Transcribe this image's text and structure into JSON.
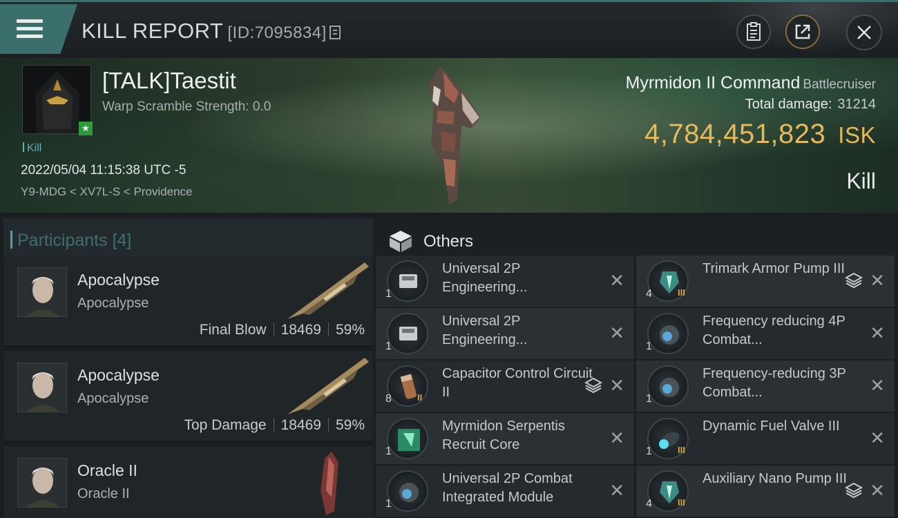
{
  "header": {
    "title": "KILL REPORT",
    "report_id": "[ID:7095834]"
  },
  "victim": {
    "name": "[TALK]Taestit",
    "warp_scramble": "Warp Scramble Strength: 0.0",
    "tag": "Kill",
    "datetime": "2022/05/04 11:15:38 UTC -5",
    "location": "Y9-MDG < XV7L-S < Providence",
    "ship": "Myrmidon II Command",
    "ship_class": "Battlecruiser",
    "total_damage_label": "Total damage:",
    "total_damage": "31214",
    "isk_value": "4,784,451,823",
    "isk_unit": "ISK",
    "result": "Kill"
  },
  "participants": {
    "label": "Participants",
    "count": "[4]",
    "rows": [
      {
        "ship": "Apocalypse",
        "type": "Apocalypse",
        "role": "Final Blow",
        "damage": "18469",
        "percent": "59%"
      },
      {
        "ship": "Apocalypse",
        "type": "Apocalypse",
        "role": "Top Damage",
        "damage": "18469",
        "percent": "59%"
      },
      {
        "ship": "Oracle II",
        "type": "Oracle II",
        "role": "",
        "damage": "",
        "percent": ""
      }
    ]
  },
  "others": {
    "label": "Others",
    "items": [
      {
        "name": "Universal 2P Engineering...",
        "qty": "1",
        "tier": "",
        "stack": false,
        "icon": "chip-icon"
      },
      {
        "name": "Trimark Armor Pump III",
        "qty": "4",
        "tier": "III",
        "stack": true,
        "icon": "armor-rig-icon"
      },
      {
        "name": "Universal 2P Engineering...",
        "qty": "1",
        "tier": "",
        "stack": false,
        "icon": "chip-icon"
      },
      {
        "name": "Frequency  reducing 4P Combat...",
        "qty": "1",
        "tier": "",
        "stack": false,
        "icon": "lens-icon"
      },
      {
        "name": "Capacitor Control Circuit II",
        "qty": "8",
        "tier": "II",
        "stack": true,
        "icon": "capacitor-icon"
      },
      {
        "name": "Frequency-reducing 3P Combat...",
        "qty": "1",
        "tier": "",
        "stack": false,
        "icon": "lens-icon"
      },
      {
        "name": "Myrmidon Serpentis Recruit Core",
        "qty": "1",
        "tier": "",
        "stack": false,
        "icon": "core-icon"
      },
      {
        "name": "Dynamic Fuel Valve III",
        "qty": "1",
        "tier": "III",
        "stack": false,
        "icon": "fuel-valve-icon"
      },
      {
        "name": "Universal 2P Combat Integrated Module",
        "qty": "1",
        "tier": "",
        "stack": false,
        "icon": "lens-icon"
      },
      {
        "name": "Auxiliary Nano Pump III",
        "qty": "4",
        "tier": "III",
        "stack": true,
        "icon": "nano-pump-icon"
      }
    ]
  },
  "colors": {
    "accent_teal": "#3a6f6b",
    "isk_gold": "#e7b95a",
    "tier_gold": "#d9a640"
  }
}
